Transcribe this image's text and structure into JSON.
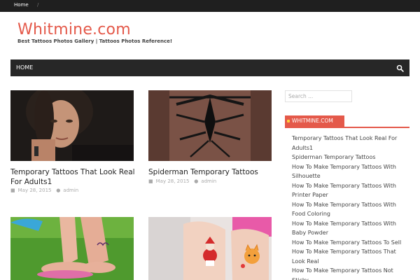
{
  "topbar": {
    "breadcrumb_home": "Home",
    "separator": "/"
  },
  "header": {
    "site_title": "Whitmine.com",
    "tagline": "Best Tattoos Photos Gallery | Tattoos Photos Reference!"
  },
  "nav": {
    "home_label": "HOME",
    "search_icon": "search-icon"
  },
  "posts": [
    {
      "title": "Temporary Tattoos That Look Real For Adults1",
      "date": "May 28, 2015",
      "author": "admin"
    },
    {
      "title": "Spiderman Temporary Tattoos",
      "date": "May 28, 2015",
      "author": "admin"
    }
  ],
  "sidebar": {
    "search_placeholder": "Search ...",
    "widget_title": "WHITMINE.COM",
    "items": [
      "Temporary Tattoos That Look Real For Adults1",
      "Spiderman Temporary Tattoos",
      "How To Make Temporary Tattoos With Silhouette",
      "How To Make Temporary Tattoos With Printer Paper",
      "How To Make Temporary Tattoos With Food Coloring",
      "How To Make Temporary Tattoos With Baby Powder",
      "How To Make Temporary Tattoos To Sell",
      "How To Make Temporary Tattoos That Look Real",
      "How To Make Temporary Tattoos Not Sticky"
    ]
  },
  "colors": {
    "accent": "#e4594a",
    "nav_bg": "#272727",
    "topbar_bg": "#1f1f1f"
  }
}
